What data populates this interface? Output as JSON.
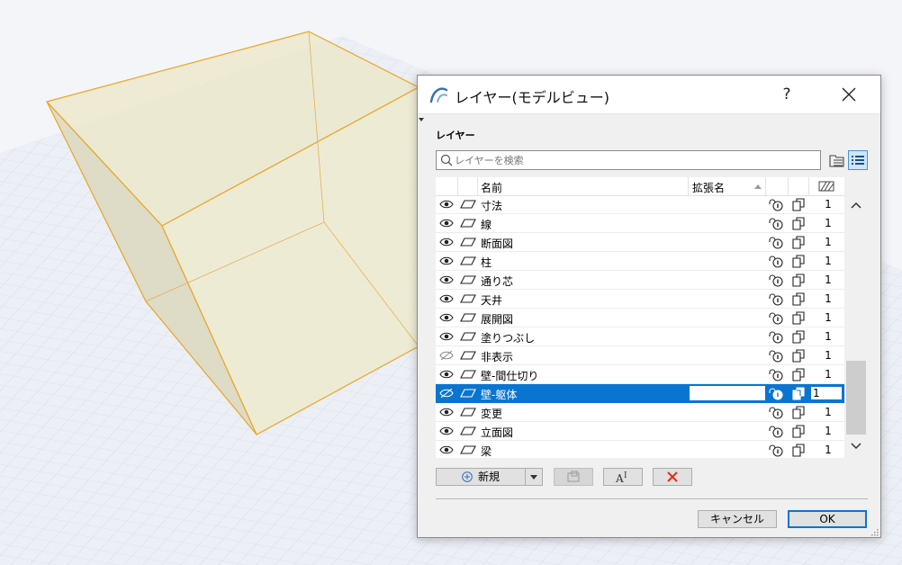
{
  "dialog": {
    "title": "レイヤー(モデルビュー)",
    "help_label": "?",
    "section_label": "レイヤー",
    "search": {
      "placeholder": "レイヤーを検索",
      "value": ""
    },
    "columns": {
      "name": "名前",
      "extension": "拡張名"
    },
    "layers": [
      {
        "name": "寸法",
        "visible": true,
        "pen": "1"
      },
      {
        "name": "線",
        "visible": true,
        "pen": "1"
      },
      {
        "name": "断面図",
        "visible": true,
        "pen": "1"
      },
      {
        "name": "柱",
        "visible": true,
        "pen": "1"
      },
      {
        "name": "通り芯",
        "visible": true,
        "pen": "1"
      },
      {
        "name": "天井",
        "visible": true,
        "pen": "1"
      },
      {
        "name": "展開図",
        "visible": true,
        "pen": "1"
      },
      {
        "name": "塗りつぶし",
        "visible": true,
        "pen": "1"
      },
      {
        "name": "非表示",
        "visible": false,
        "pen": "1"
      },
      {
        "name": "壁-間仕切り",
        "visible": true,
        "pen": "1"
      },
      {
        "name": "壁-躯体",
        "visible": false,
        "pen": "1",
        "selected": true
      },
      {
        "name": "変更",
        "visible": true,
        "pen": "1"
      },
      {
        "name": "立面図",
        "visible": true,
        "pen": "1"
      },
      {
        "name": "梁",
        "visible": true,
        "pen": "1"
      }
    ],
    "buttons": {
      "new_label": "新規",
      "cancel_label": "キャンセル",
      "ok_label": "OK"
    },
    "colors": {
      "selection": "#0a74d1",
      "delete_icon": "#e8281c",
      "box_fill": "#ece7cc",
      "box_edge": "#e8a628"
    }
  }
}
